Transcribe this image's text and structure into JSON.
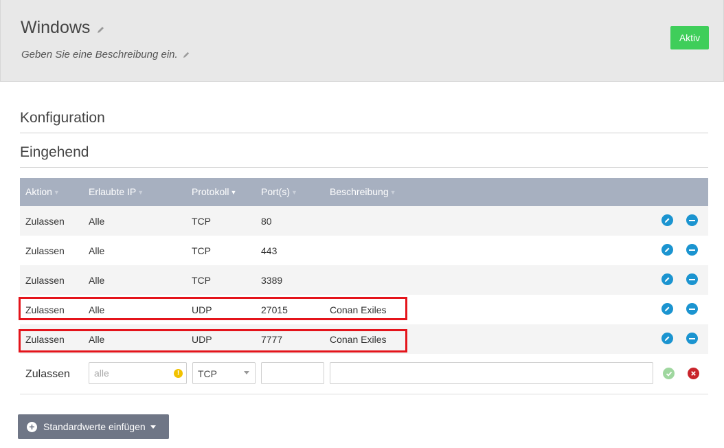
{
  "header": {
    "title": "Windows",
    "description_placeholder": "Geben Sie eine Beschreibung ein.",
    "status_label": "Aktiv"
  },
  "sections": {
    "config": "Konfiguration",
    "inbound": "Eingehend"
  },
  "table": {
    "columns": {
      "action": "Aktion",
      "ip": "Erlaubte IP",
      "protocol": "Protokoll",
      "ports": "Port(s)",
      "description": "Beschreibung"
    },
    "rows": [
      {
        "action": "Zulassen",
        "ip": "Alle",
        "protocol": "TCP",
        "port": "80",
        "description": ""
      },
      {
        "action": "Zulassen",
        "ip": "Alle",
        "protocol": "TCP",
        "port": "443",
        "description": ""
      },
      {
        "action": "Zulassen",
        "ip": "Alle",
        "protocol": "TCP",
        "port": "3389",
        "description": ""
      },
      {
        "action": "Zulassen",
        "ip": "Alle",
        "protocol": "UDP",
        "port": "27015",
        "description": "Conan Exiles"
      },
      {
        "action": "Zulassen",
        "ip": "Alle",
        "protocol": "UDP",
        "port": "7777",
        "description": "Conan Exiles"
      }
    ],
    "new_row": {
      "action": "Zulassen",
      "ip_placeholder": "alle",
      "protocol_value": "TCP",
      "port_value": "",
      "description_value": ""
    }
  },
  "footer": {
    "defaults_button": "Standardwerte einfügen"
  },
  "colors": {
    "active": "#3fce5a",
    "table_header": "#a7b0c0",
    "action_icon": "#1b94d0",
    "highlight": "#e4141b",
    "cancel": "#c9242b"
  }
}
